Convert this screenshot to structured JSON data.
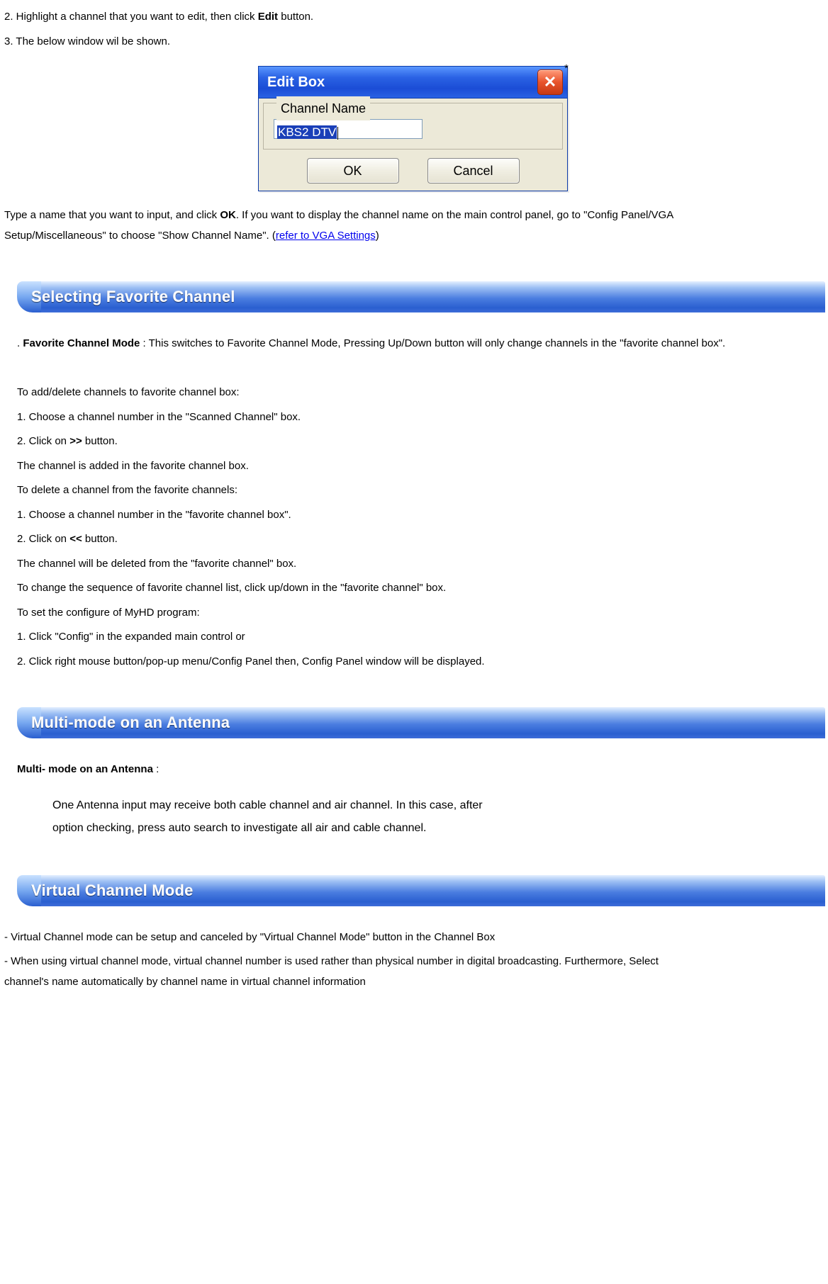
{
  "intro": {
    "step2_a": "2. Highlight a channel that you want to edit, then click ",
    "step2_edit": "Edit",
    "step2_b": " button.",
    "step3": "3. The below window wil be shown."
  },
  "dialog": {
    "asterisk": "*",
    "title": "Edit Box",
    "close_glyph": "✕",
    "group_label": "Channel Name",
    "input_value": "KBS2 DTV",
    "ok_label": "OK",
    "cancel_label": "Cancel"
  },
  "after_dialog": {
    "p_a": "Type a name that you want to input, and click ",
    "p_ok": "OK",
    "p_b": ". If you want to display the channel name on the main control panel, go to \"Config Panel/VGA Setup/Miscellaneous\" to choose \"Show Channel Name\".  (",
    "link_text": "refer to VGA Settings",
    "p_c": ")"
  },
  "headers": {
    "selecting": "Selecting Favorite Channel",
    "multimode": "Multi-mode on an Antenna",
    "virtual": "Virtual Channel Mode"
  },
  "favorite": {
    "mode_a": ". ",
    "mode_label": "Favorite Channel Mode",
    "mode_b": " : This  switches to Favorite Channel Mode, Pressing Up/Down button will only change channels in the \"favorite channel box\".",
    "add_title": "To add/delete channels to favorite channel box:",
    "add_1": "1. Choose a channel number in the \"Scanned Channel\" box.",
    "add_2a": "2. Click on  ",
    "add_2_btn": ">>",
    "add_2b": " button.",
    "add_result": "The channel is added in the favorite channel box.",
    "del_title": "To delete a channel from the favorite channels:",
    "del_1": "1. Choose a channel number in the \"favorite channel box\".",
    "del_2a": "2. Click on ",
    "del_2_btn": "<<",
    "del_2b": " button.",
    "del_result": "The channel will be deleted from the \"favorite channel\" box.",
    "seq": "To change the sequence of favorite channel list, click up/down in the \"favorite channel\" box.",
    "cfg_title": "To set the configure of MyHD program:",
    "cfg_1": "1. Click \"Config\" in the expanded main control or",
    "cfg_2": "2. Click right mouse button/pop-up menu/Config Panel then, Config Panel window will be displayed."
  },
  "multimode": {
    "label_a": "Multi- mode on an Antenna",
    "label_b": " :",
    "desc1": "One Antenna input may receive both cable channel and air channel. In this case, after",
    "desc2": "option checking, press auto search to investigate all air and cable channel."
  },
  "virtual": {
    "p1": "- Virtual Channel mode can be setup and canceled by \"Virtual Channel Mode\" button in the Channel Box",
    "p2": "- When using virtual channel mode, virtual channel number is used rather than physical number in digital broadcasting. Furthermore, Select channel's name automatically by channel name in virtual channel information"
  }
}
